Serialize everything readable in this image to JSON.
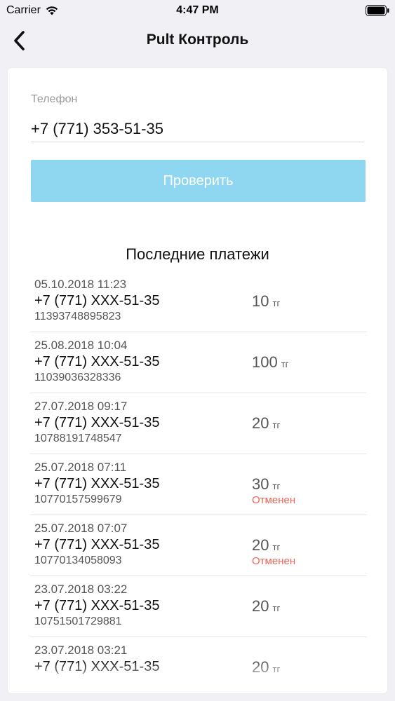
{
  "status_bar": {
    "carrier": "Carrier",
    "time": "4:47 PM",
    "wifi_icon": "wifi-icon",
    "battery_icon": "battery-icon"
  },
  "nav": {
    "title": "Pult Контроль",
    "back_icon": "chevron-left-icon"
  },
  "form": {
    "phone_label": "Телефон",
    "phone_value": "+7 (771) 353-51-35",
    "check_button": "Проверить",
    "button_color": "#8fd6f0"
  },
  "payments": {
    "title": "Последние платежи",
    "currency": "тг",
    "cancelled_color": "#e9655a",
    "items": [
      {
        "date": "05.10.2018 11:23",
        "phone": "+7 (771) XXX-51-35",
        "id": "11393748895823",
        "amount": "10",
        "status": ""
      },
      {
        "date": "25.08.2018 10:04",
        "phone": "+7 (771) XXX-51-35",
        "id": "11039036328336",
        "amount": "100",
        "status": ""
      },
      {
        "date": "27.07.2018 09:17",
        "phone": "+7 (771) XXX-51-35",
        "id": "10788191748547",
        "amount": "20",
        "status": ""
      },
      {
        "date": "25.07.2018 07:11",
        "phone": "+7 (771) XXX-51-35",
        "id": "10770157599679",
        "amount": "30",
        "status": "Отменен"
      },
      {
        "date": "25.07.2018 07:07",
        "phone": "+7 (771) XXX-51-35",
        "id": "10770134058093",
        "amount": "20",
        "status": "Отменен"
      },
      {
        "date": "23.07.2018 03:22",
        "phone": "+7 (771) XXX-51-35",
        "id": "10751501729881",
        "amount": "20",
        "status": ""
      },
      {
        "date": "23.07.2018 03:21",
        "phone": "+7 (771) XXX-51-35",
        "id": "",
        "amount": "20",
        "status": ""
      }
    ]
  }
}
